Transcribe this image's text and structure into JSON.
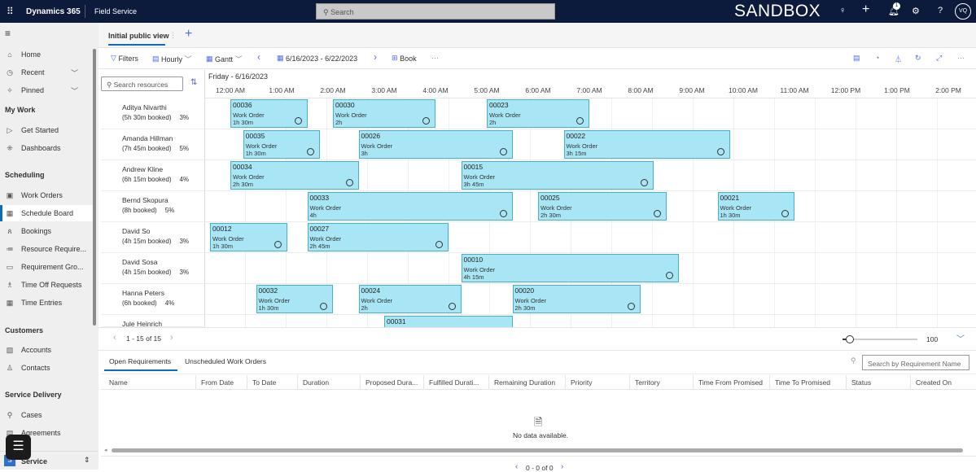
{
  "topbar": {
    "brand": "Dynamics 365",
    "app": "Field Service",
    "search_placeholder": "Search",
    "environment": "SANDBOX",
    "notification_count": "1",
    "avatar": "VQ"
  },
  "sidebar": {
    "items": [
      {
        "label": "Home",
        "icon": "home-icon"
      },
      {
        "label": "Recent",
        "icon": "clock-icon"
      },
      {
        "label": "Pinned",
        "icon": "pin-icon"
      }
    ],
    "groups": [
      {
        "title": "My Work",
        "items": [
          {
            "label": "Get Started",
            "icon": "play-icon"
          },
          {
            "label": "Dashboards",
            "icon": "dashboard-icon"
          }
        ]
      },
      {
        "title": "Scheduling",
        "items": [
          {
            "label": "Work Orders",
            "icon": "clipboard-icon"
          },
          {
            "label": "Schedule Board",
            "icon": "calendar-icon",
            "selected": true
          },
          {
            "label": "Bookings",
            "icon": "people-icon"
          },
          {
            "label": "Resource Require...",
            "icon": "list-person-icon"
          },
          {
            "label": "Requirement Gro...",
            "icon": "card-icon"
          },
          {
            "label": "Time Off Requests",
            "icon": "person-clock-icon"
          },
          {
            "label": "Time Entries",
            "icon": "calendar-icon"
          }
        ]
      },
      {
        "title": "Customers",
        "items": [
          {
            "label": "Accounts",
            "icon": "building-icon"
          },
          {
            "label": "Contacts",
            "icon": "person-icon"
          }
        ]
      },
      {
        "title": "Service Delivery",
        "items": [
          {
            "label": "Cases",
            "icon": "wrench-icon"
          },
          {
            "label": "Agreements",
            "icon": "document-icon"
          }
        ]
      }
    ],
    "area": {
      "badge": "S",
      "label": "Service"
    }
  },
  "tabs": {
    "active": "Initial public view"
  },
  "toolbar": {
    "filters": "Filters",
    "hourly": "Hourly",
    "gantt": "Gantt",
    "date_range": "6/16/2023 - 6/22/2023",
    "book": "Book"
  },
  "board": {
    "search_placeholder": "Search resources",
    "date_label": "Friday - 6/16/2023",
    "hours": [
      "12:00 AM",
      "1:00 AM",
      "2:00 AM",
      "3:00 AM",
      "4:00 AM",
      "5:00 AM",
      "6:00 AM",
      "7:00 AM",
      "8:00 AM",
      "9:00 AM",
      "10:00 AM",
      "11:00 AM",
      "12:00 PM",
      "1:00 PM",
      "2:00 PM"
    ],
    "resources": [
      {
        "name": "Aditya Nivarthi",
        "booked": "(5h 30m booked)",
        "pct": "3%"
      },
      {
        "name": "Amanda Hillman",
        "booked": "(7h 45m booked)",
        "pct": "5%"
      },
      {
        "name": "Andrew Kline",
        "booked": "(6h 15m booked)",
        "pct": "4%"
      },
      {
        "name": "Bernd Skopura",
        "booked": "(8h booked)",
        "pct": "5%"
      },
      {
        "name": "David So",
        "booked": "(4h 15m booked)",
        "pct": "3%"
      },
      {
        "name": "David Sosa",
        "booked": "(4h 15m booked)",
        "pct": "3%"
      },
      {
        "name": "Hanna Peters",
        "booked": "(6h booked)",
        "pct": "4%"
      },
      {
        "name": "Jule Heinrich",
        "booked": "",
        "pct": ""
      }
    ],
    "bookings": [
      {
        "row": 0,
        "id": "00036",
        "type": "Work Order",
        "duration": "1h 30m",
        "start": 0,
        "hours": 1.5
      },
      {
        "row": 0,
        "id": "00030",
        "type": "Work Order",
        "duration": "2h",
        "start": 2,
        "hours": 2
      },
      {
        "row": 0,
        "id": "00023",
        "type": "Work Order",
        "duration": "2h",
        "start": 5,
        "hours": 2
      },
      {
        "row": 1,
        "id": "00035",
        "type": "Work Order",
        "duration": "1h 30m",
        "start": 0.25,
        "hours": 1.5
      },
      {
        "row": 1,
        "id": "00026",
        "type": "Work Order",
        "duration": "3h",
        "start": 2.5,
        "hours": 3
      },
      {
        "row": 1,
        "id": "00022",
        "type": "Work Order",
        "duration": "3h 15m",
        "start": 6.5,
        "hours": 3.25
      },
      {
        "row": 2,
        "id": "00034",
        "type": "Work Order",
        "duration": "2h 30m",
        "start": 0,
        "hours": 2.5
      },
      {
        "row": 2,
        "id": "00015",
        "type": "Work Order",
        "duration": "3h 45m",
        "start": 4.5,
        "hours": 3.75
      },
      {
        "row": 3,
        "id": "00033",
        "type": "Work Order",
        "duration": "4h",
        "start": 1.5,
        "hours": 4
      },
      {
        "row": 3,
        "id": "00025",
        "type": "Work Order",
        "duration": "2h 30m",
        "start": 6,
        "hours": 2.5
      },
      {
        "row": 3,
        "id": "00021",
        "type": "Work Order",
        "duration": "1h 30m",
        "start": 9.5,
        "hours": 1.5
      },
      {
        "row": 4,
        "id": "00012",
        "type": "Work Order",
        "duration": "1h 30m",
        "start": -0.4,
        "hours": 1.5
      },
      {
        "row": 4,
        "id": "00027",
        "type": "Work Order",
        "duration": "2h 45m",
        "start": 1.5,
        "hours": 2.75
      },
      {
        "row": 5,
        "id": "00010",
        "type": "Work Order",
        "duration": "4h 15m",
        "start": 4.5,
        "hours": 4.25
      },
      {
        "row": 6,
        "id": "00032",
        "type": "Work Order",
        "duration": "1h 30m",
        "start": 0.5,
        "hours": 1.5
      },
      {
        "row": 6,
        "id": "00024",
        "type": "Work Order",
        "duration": "2h",
        "start": 2.5,
        "hours": 2
      },
      {
        "row": 6,
        "id": "00020",
        "type": "Work Order",
        "duration": "2h 30m",
        "start": 5.5,
        "hours": 2.5
      },
      {
        "row": 7,
        "id": "00031",
        "type": "Work Order",
        "duration": "",
        "start": 3,
        "hours": 2.5
      }
    ],
    "pagination": "1 - 15 of 15",
    "zoom_value": "100",
    "zoom_fraction": 0.1
  },
  "bottom": {
    "tabs": [
      "Open Requirements",
      "Unscheduled Work Orders"
    ],
    "search_placeholder": "Search by Requirement Name",
    "columns": [
      "Name",
      "From Date",
      "To Date",
      "Duration",
      "Proposed Dura...",
      "Fulfilled Durati...",
      "Remaining Duration",
      "Priority",
      "Territory",
      "Time From Promised",
      "Time To Promised",
      "Status",
      "Created On"
    ],
    "empty": "No data available.",
    "pagination": "0 - 0 of 0"
  },
  "colors": {
    "topbar": "#0c1a3b",
    "booking": "#a8e6f6",
    "accent": "#0f6cbd"
  }
}
